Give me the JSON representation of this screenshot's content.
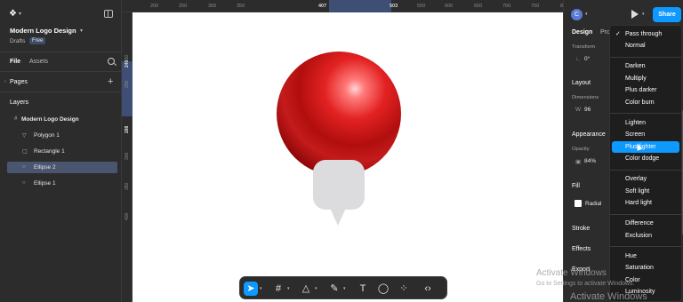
{
  "left_panel": {
    "logo_icon": "figma-logo",
    "file_title": "Modern Logo Design",
    "location": "Drafts",
    "plan_badge": "Free",
    "tabs": [
      "File",
      "Assets"
    ],
    "pages_label": "Pages",
    "layers_label": "Layers",
    "layers": [
      {
        "label": "Modern Logo Design",
        "icon": "frame-icon",
        "selected": false
      },
      {
        "label": "Polygon 1",
        "icon": "polygon-icon",
        "selected": false
      },
      {
        "label": "Rectangle 1",
        "icon": "rectangle-icon",
        "selected": false
      },
      {
        "label": "Ellipse 2",
        "icon": "ellipse-icon",
        "selected": true
      },
      {
        "label": "Ellipse 1",
        "icon": "ellipse-icon",
        "selected": false
      }
    ]
  },
  "ruler_top": [
    "200",
    "250",
    "300",
    "350",
    "407",
    "503",
    "550",
    "600",
    "650",
    "700",
    "750",
    "800",
    "850"
  ],
  "ruler_left": [
    "150",
    "200",
    "240",
    "288",
    "300",
    "350",
    "400"
  ],
  "toolbar": {
    "tools": [
      "move-tool",
      "frame-tool",
      "shape-tool",
      "pen-tool",
      "text-tool",
      "comment-tool",
      "actions-tool",
      "dev-mode-tool"
    ]
  },
  "right_panel": {
    "avatar_letter": "C",
    "share_label": "Share",
    "tabs": [
      "Design",
      "Prototype"
    ],
    "transform_label": "Transform",
    "rotation_value": "0°",
    "layout_label": "Layout",
    "dimensions_label": "Dimensions",
    "width_prefix": "W",
    "width_value": "96",
    "appearance_label": "Appearance",
    "opacity_label": "Opacity",
    "opacity_value": "84%",
    "fill_label": "Fill",
    "fill_type": "Radial",
    "stroke_label": "Stroke",
    "effects_label": "Effects",
    "export_label": "Export"
  },
  "blend_menu": {
    "selected": "Pass through",
    "highlighted": "Plus lighter",
    "groups": [
      [
        "Pass through",
        "Normal"
      ],
      [
        "Darken",
        "Multiply",
        "Plus darker",
        "Color burn"
      ],
      [
        "Lighten",
        "Screen",
        "Plus lighter",
        "Color dodge"
      ],
      [
        "Overlay",
        "Soft light",
        "Hard light"
      ],
      [
        "Difference",
        "Exclusion"
      ],
      [
        "Hue",
        "Saturation",
        "Color",
        "Luminosity"
      ]
    ]
  },
  "watermark": {
    "title": "Activate Windows",
    "subtitle": "Go to Settings to activate Windows."
  },
  "colors": {
    "accent": "#0d99ff",
    "shape_red": "#c41b1b",
    "shape_gray": "#dcdcdf",
    "selected_layer": "#4a5570"
  }
}
